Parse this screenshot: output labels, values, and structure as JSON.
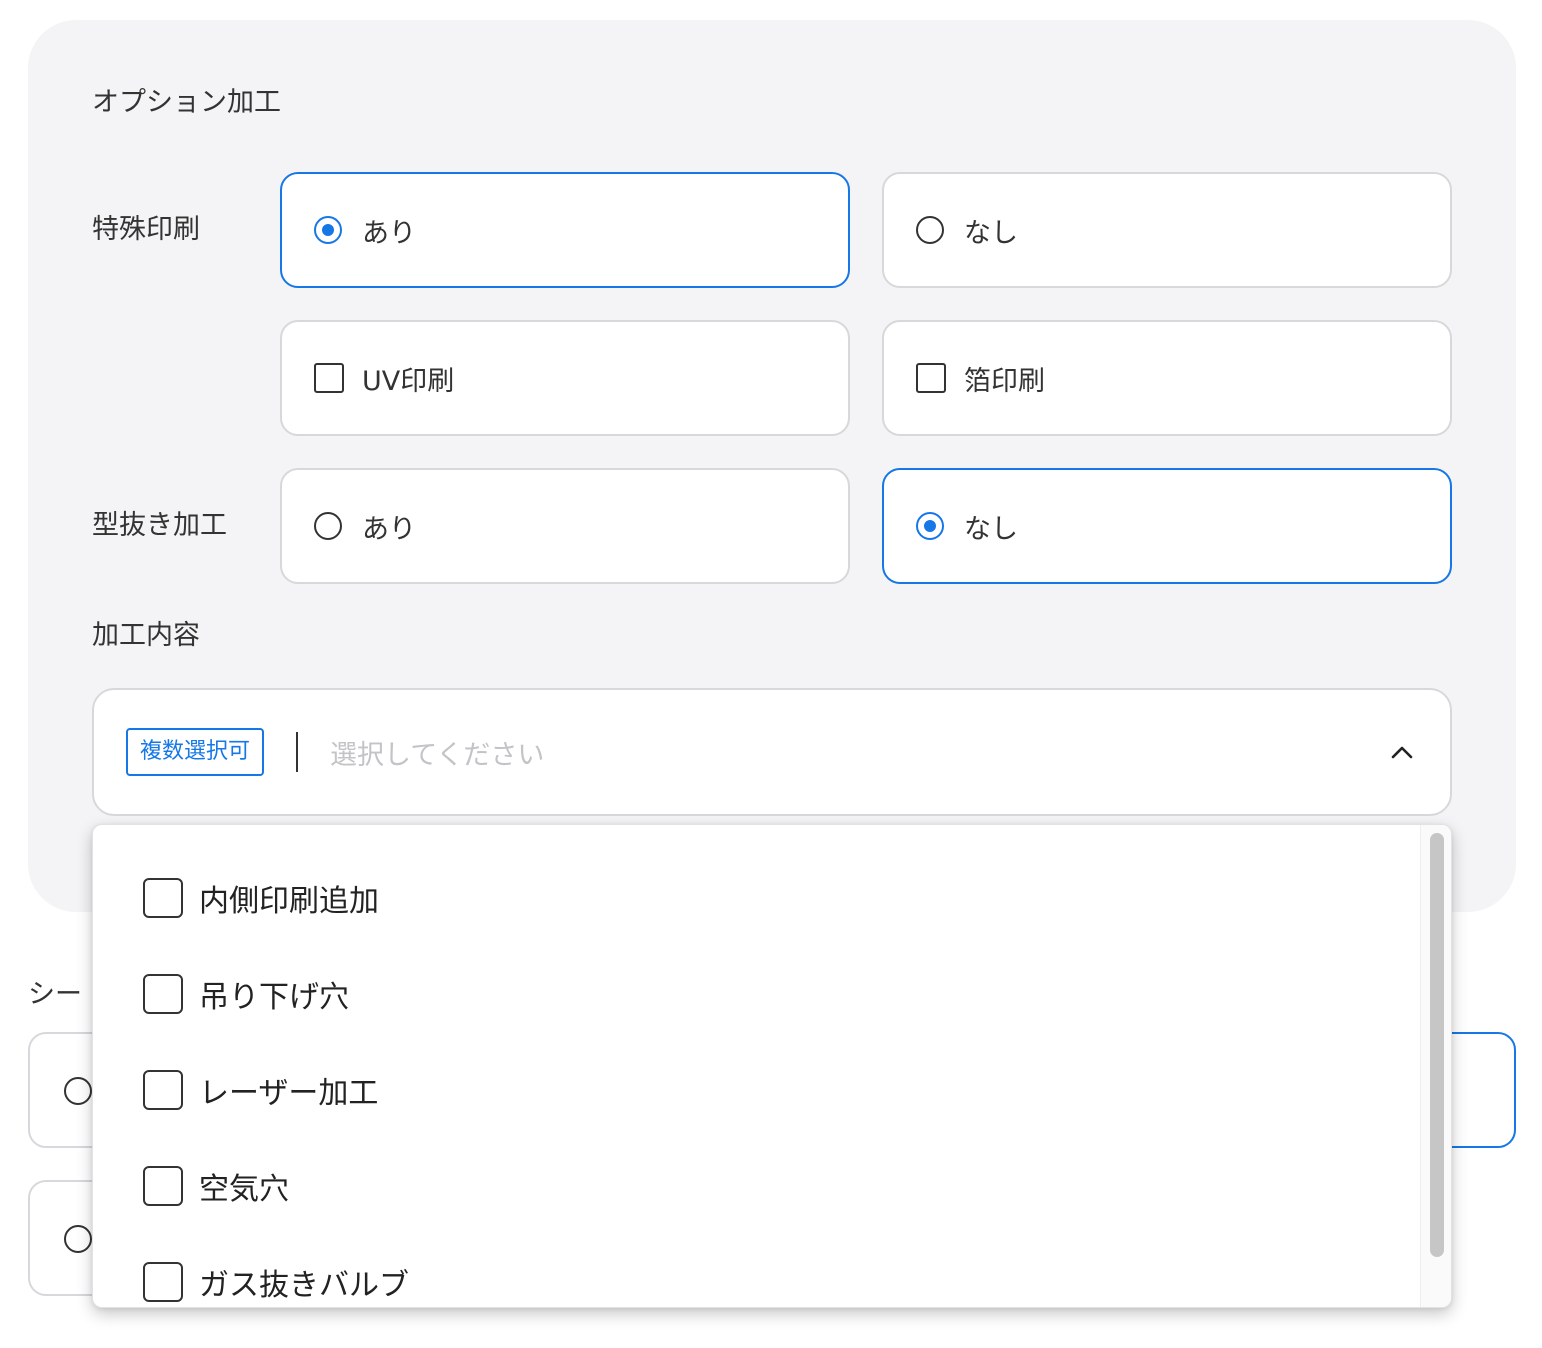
{
  "options": {
    "title": "オプション加工",
    "special_print": {
      "label": "特殊印刷",
      "yes": "あり",
      "no": "なし",
      "selected": "yes",
      "sub_options": [
        "UV印刷",
        "箔印刷"
      ]
    },
    "die_cut": {
      "label": "型抜き加工",
      "yes": "あり",
      "no": "なし",
      "selected": "no"
    },
    "processing": {
      "label": "加工内容",
      "badge": "複数選択可",
      "placeholder": "選択してください",
      "items": [
        "内側印刷追加",
        "吊り下げ穴",
        "レーザー加工",
        "空気穴",
        "ガス抜きバルブ"
      ]
    }
  },
  "below": {
    "label_partial": "シー"
  },
  "colors": {
    "accent": "#1677e6",
    "panel_bg": "#f4f4f6",
    "border": "#d8d8dc",
    "placeholder": "#c4c4c8"
  }
}
